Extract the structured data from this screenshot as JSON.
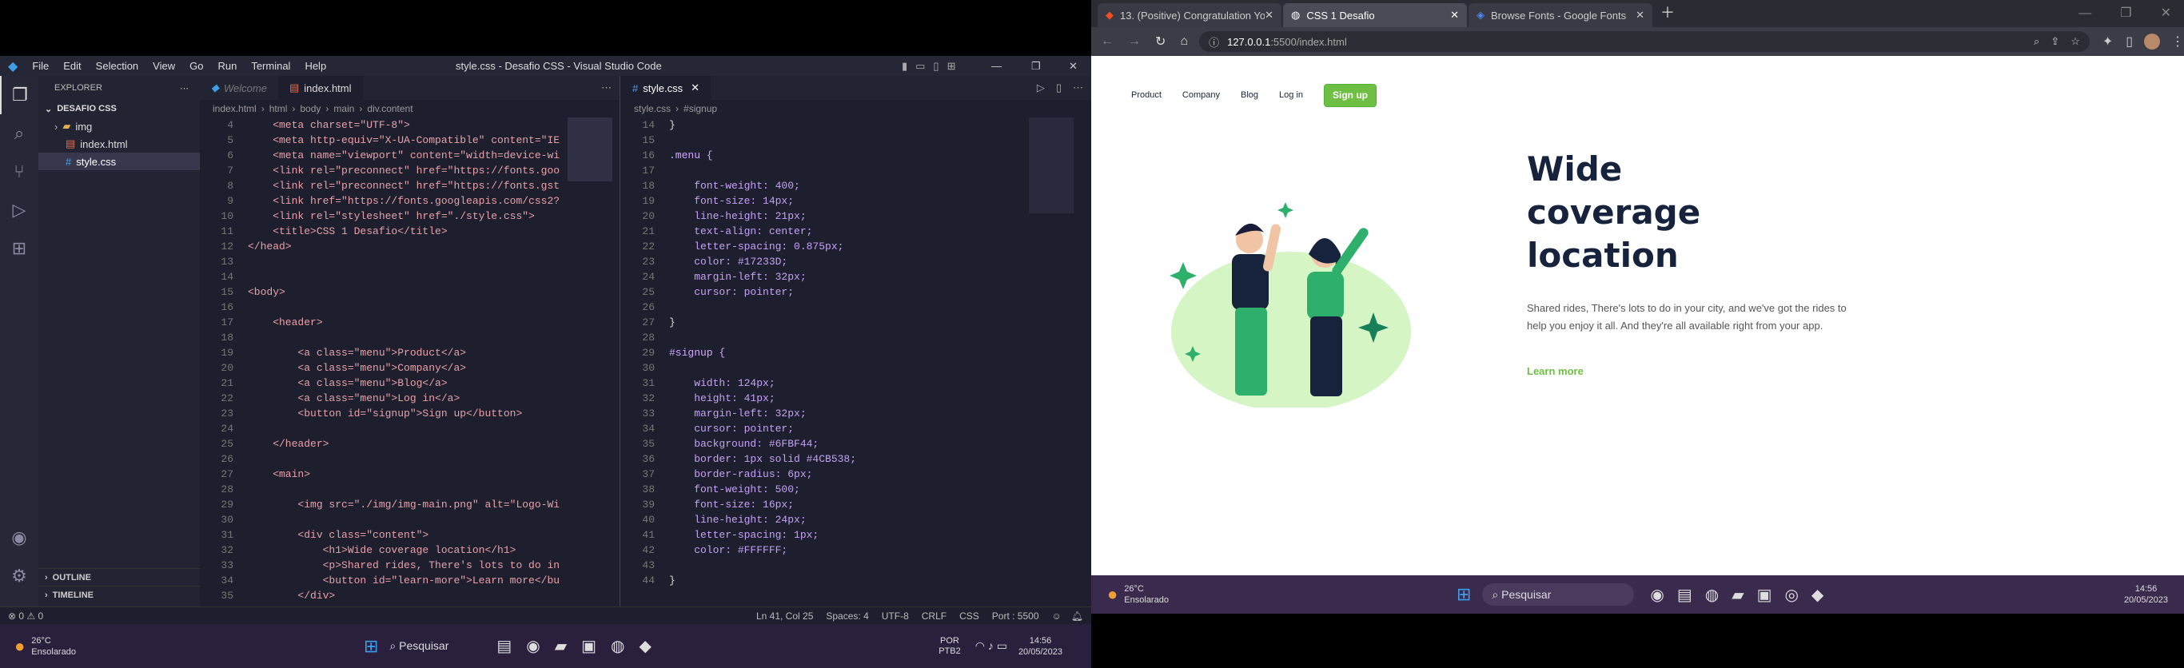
{
  "vscode": {
    "title": "style.css - Desafio CSS - Visual Studio Code",
    "menu": [
      "File",
      "Edit",
      "Selection",
      "View",
      "Go",
      "Run",
      "Terminal",
      "Help"
    ],
    "explorer_label": "EXPLORER",
    "project": "DESAFIO CSS",
    "files": [
      "img",
      "index.html",
      "style.css"
    ],
    "outline": "OUTLINE",
    "timeline": "TIMELINE",
    "tabs_left": [
      "Welcome",
      "index.html"
    ],
    "tab_right": "style.css",
    "breadcrumb_left": [
      "index.html",
      "html",
      "body",
      "main",
      "div.content"
    ],
    "breadcrumb_right": [
      "style.css",
      "#signup"
    ],
    "html_lines": [
      {
        "n": "4",
        "t": "    <meta charset=\"UTF-8\">"
      },
      {
        "n": "5",
        "t": "    <meta http-equiv=\"X-UA-Compatible\" content=\"IE"
      },
      {
        "n": "6",
        "t": "    <meta name=\"viewport\" content=\"width=device-wi"
      },
      {
        "n": "7",
        "t": "    <link rel=\"preconnect\" href=\"https://fonts.goo"
      },
      {
        "n": "8",
        "t": "    <link rel=\"preconnect\" href=\"https://fonts.gst"
      },
      {
        "n": "9",
        "t": "    <link href=\"https://fonts.googleapis.com/css2?"
      },
      {
        "n": "10",
        "t": "    <link rel=\"stylesheet\" href=\"./style.css\">"
      },
      {
        "n": "11",
        "t": "    <title>CSS 1 Desafio</title>"
      },
      {
        "n": "12",
        "t": "</head>"
      },
      {
        "n": "13",
        "t": ""
      },
      {
        "n": "14",
        "t": ""
      },
      {
        "n": "15",
        "t": "<body>"
      },
      {
        "n": "16",
        "t": ""
      },
      {
        "n": "17",
        "t": "    <header>"
      },
      {
        "n": "18",
        "t": ""
      },
      {
        "n": "19",
        "t": "        <a class=\"menu\">Product</a>"
      },
      {
        "n": "20",
        "t": "        <a class=\"menu\">Company</a>"
      },
      {
        "n": "21",
        "t": "        <a class=\"menu\">Blog</a>"
      },
      {
        "n": "22",
        "t": "        <a class=\"menu\">Log in</a>"
      },
      {
        "n": "23",
        "t": "        <button id=\"signup\">Sign up</button>"
      },
      {
        "n": "24",
        "t": ""
      },
      {
        "n": "25",
        "t": "    </header>"
      },
      {
        "n": "26",
        "t": ""
      },
      {
        "n": "27",
        "t": "    <main>"
      },
      {
        "n": "28",
        "t": ""
      },
      {
        "n": "29",
        "t": "        <img src=\"./img/img-main.png\" alt=\"Logo-Wi"
      },
      {
        "n": "30",
        "t": ""
      },
      {
        "n": "31",
        "t": "        <div class=\"content\">"
      },
      {
        "n": "32",
        "t": "            <h1>Wide coverage location</h1>"
      },
      {
        "n": "33",
        "t": "            <p>Shared rides, There's lots to do in"
      },
      {
        "n": "34",
        "t": "            <button id=\"learn-more\">Learn more</bu"
      },
      {
        "n": "35",
        "t": "        </div>"
      }
    ],
    "css_lines": [
      {
        "n": "14",
        "t": "}"
      },
      {
        "n": "15",
        "t": ""
      },
      {
        "n": "16",
        "t": ".menu {"
      },
      {
        "n": "17",
        "t": ""
      },
      {
        "n": "18",
        "t": "    font-weight: 400;"
      },
      {
        "n": "19",
        "t": "    font-size: 14px;"
      },
      {
        "n": "20",
        "t": "    line-height: 21px;"
      },
      {
        "n": "21",
        "t": "    text-align: center;"
      },
      {
        "n": "22",
        "t": "    letter-spacing: 0.875px;"
      },
      {
        "n": "23",
        "t": "    color: #17233D;"
      },
      {
        "n": "24",
        "t": "    margin-left: 32px;"
      },
      {
        "n": "25",
        "t": "    cursor: pointer;"
      },
      {
        "n": "26",
        "t": ""
      },
      {
        "n": "27",
        "t": "}"
      },
      {
        "n": "28",
        "t": ""
      },
      {
        "n": "29",
        "t": "#signup {"
      },
      {
        "n": "30",
        "t": ""
      },
      {
        "n": "31",
        "t": "    width: 124px;"
      },
      {
        "n": "32",
        "t": "    height: 41px;"
      },
      {
        "n": "33",
        "t": "    margin-left: 32px;"
      },
      {
        "n": "34",
        "t": "    cursor: pointer;"
      },
      {
        "n": "35",
        "t": "    background: #6FBF44;"
      },
      {
        "n": "36",
        "t": "    border: 1px solid #4CB538;"
      },
      {
        "n": "37",
        "t": "    border-radius: 6px;"
      },
      {
        "n": "38",
        "t": "    font-weight: 500;"
      },
      {
        "n": "39",
        "t": "    font-size: 16px;"
      },
      {
        "n": "40",
        "t": "    line-height: 24px;"
      },
      {
        "n": "41",
        "t": "    letter-spacing: 1px;"
      },
      {
        "n": "42",
        "t": "    color: #FFFFFF;"
      },
      {
        "n": "43",
        "t": ""
      },
      {
        "n": "44",
        "t": "}"
      }
    ],
    "status": {
      "errors": "0",
      "warnings": "0",
      "position": "Ln 41, Col 25",
      "spaces": "Spaces: 4",
      "encoding": "UTF-8",
      "eol": "CRLF",
      "lang": "CSS",
      "port": "Port : 5500"
    },
    "taskbar": {
      "weather_temp": "26°C",
      "weather_desc": "Ensolarado",
      "search": "Pesquisar",
      "lang": "POR",
      "layout": "PTB2",
      "time": "14:56",
      "date": "20/05/2023"
    }
  },
  "chrome": {
    "tabs": [
      "13. (Positive) Congratulation You...",
      "CSS 1 Desafio",
      "Browse Fonts - Google Fonts"
    ],
    "url_host": "127.0.0.1",
    "url_rest": ":5500/index.html",
    "page": {
      "nav": [
        "Product",
        "Company",
        "Blog",
        "Log in"
      ],
      "signup": "Sign up",
      "headline": "Wide coverage location",
      "paragraph": "Shared rides, There's lots to do in your city, and we've got the rides to help you enjoy it all. And they're all available right from your app.",
      "learn_more": "Learn more"
    },
    "taskbar": {
      "weather_temp": "26°C",
      "weather_desc": "Ensolarado",
      "search": "Pesquisar",
      "time": "14:56",
      "date": "20/05/2023"
    }
  },
  "colors": {
    "signup_bg": "#6FBF44",
    "signup_border": "#4CB538",
    "heading": "#17233D",
    "learn_more": "#6FBF44"
  }
}
